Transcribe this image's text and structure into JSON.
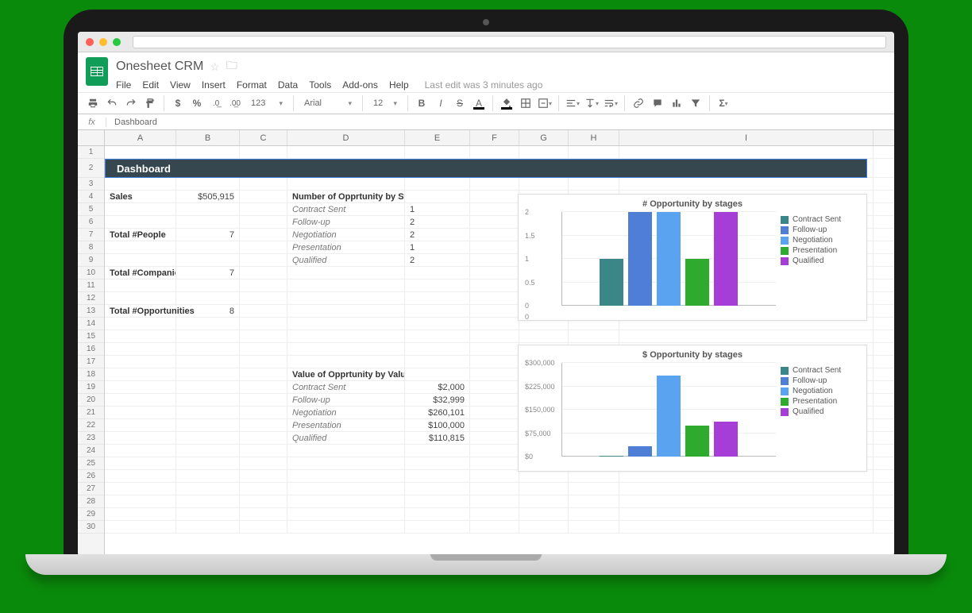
{
  "doc": {
    "title": "Onesheet CRM",
    "last_edit": "Last edit was 3 minutes ago"
  },
  "menu": [
    "File",
    "Edit",
    "View",
    "Insert",
    "Format",
    "Data",
    "Tools",
    "Add-ons",
    "Help"
  ],
  "toolbar": {
    "font": "Arial",
    "fontsize": "12",
    "zoom": "123"
  },
  "fx": {
    "value": "Dashboard"
  },
  "columns": [
    "A",
    "B",
    "C",
    "D",
    "E",
    "F",
    "G",
    "H",
    "I"
  ],
  "dashboard_label": "Dashboard",
  "metrics": {
    "sales_label": "Sales",
    "sales_value": "$505,915",
    "people_label": "Total #People",
    "people_value": "7",
    "companies_label": "Total #Companies",
    "companies_value": "7",
    "opps_label": "Total #Opportunities",
    "opps_value": "8"
  },
  "stage_table": {
    "title": "Number of Opprtunity by Stage",
    "rows": [
      {
        "label": "Contract Sent",
        "value": "1"
      },
      {
        "label": "Follow-up",
        "value": "2"
      },
      {
        "label": "Negotiation",
        "value": "2"
      },
      {
        "label": "Presentation",
        "value": "1"
      },
      {
        "label": "Qualified",
        "value": "2"
      }
    ]
  },
  "value_table": {
    "title": "Value of Opprtunity by Value",
    "rows": [
      {
        "label": "Contract Sent",
        "value": "$2,000"
      },
      {
        "label": "Follow-up",
        "value": "$32,999"
      },
      {
        "label": "Negotiation",
        "value": "$260,101"
      },
      {
        "label": "Presentation",
        "value": "$100,000"
      },
      {
        "label": "Qualified",
        "value": "$110,815"
      }
    ]
  },
  "chart1": {
    "title": "# Opportunity by stages",
    "yticks": [
      "2",
      "1.5",
      "1",
      "0.5",
      "0"
    ],
    "legend": [
      "Contract Sent",
      "Follow-up",
      "Negotiation",
      "Presentation",
      "Qualified"
    ]
  },
  "chart2": {
    "title": "$ Opportunity by stages",
    "yticks": [
      "$300,000",
      "$225,000",
      "$150,000",
      "$75,000",
      "$0"
    ],
    "legend": [
      "Contract Sent",
      "Follow-up",
      "Negotiation",
      "Presentation",
      "Qualified"
    ]
  },
  "chart_data": [
    {
      "type": "bar",
      "title": "# Opportunity by stages",
      "categories": [
        "Contract Sent",
        "Follow-up",
        "Negotiation",
        "Presentation",
        "Qualified"
      ],
      "values": [
        1,
        2,
        2,
        1,
        2
      ],
      "ylim": [
        0,
        2
      ]
    },
    {
      "type": "bar",
      "title": "$ Opportunity by stages",
      "categories": [
        "Contract Sent",
        "Follow-up",
        "Negotiation",
        "Presentation",
        "Qualified"
      ],
      "values": [
        2000,
        32999,
        260101,
        100000,
        110815
      ],
      "ylim": [
        0,
        300000
      ]
    }
  ]
}
